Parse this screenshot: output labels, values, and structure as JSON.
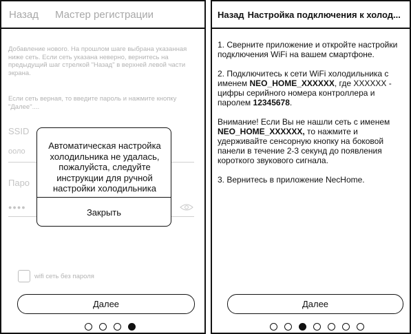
{
  "screen1": {
    "header": {
      "back": "Назад",
      "title": "Мастер регистрации"
    },
    "intro": "Добавление нового. На прошлом шаге выбрана указанная ниже сеть. Если сеть указана неверно, вернитесь на предыдущий шаг стрелкой \"Назад\" в верхней левой части экрана.",
    "intro2": "Если сеть верная, то введите пароль и нажмите кнопку \"Далее\"....",
    "ssid_label": "SSID",
    "ssid_value": "ооло",
    "password_label": "Паро",
    "password_value": "●●●●",
    "checkbox_label": "wifi сеть без пароля",
    "next_button": "Далее",
    "dialog": {
      "message": "Автоматическая настройка холодильника не удалась, пожалуйста, следуйте инструкции для ручной настройки холодильника",
      "close_button": "Закрыть"
    },
    "dots": {
      "total": 4,
      "active": 3
    }
  },
  "screen2": {
    "header": {
      "back": "Назад",
      "title": "Настройка подключения к холод..."
    },
    "step1": "1. Сверните приложение и откройте настройки подключения WiFi на вашем смартфоне.",
    "step2_a": "2. Подключитесь к сети WiFi холодильника с именем ",
    "step2_ssid": "NEO_HOME_XXXXXX",
    "step2_b": ", где XXXXXX - цифры серийного номера контроллера и паролем ",
    "step2_pass": "12345678",
    "step2_c": ".",
    "note_a": "Внимание! Если Вы не нашли сеть с именем ",
    "note_ssid": "NEO_HOME_XXXXXX,",
    "note_b": " то нажмите и удерживайте сенсорную кнопку на боковой панели в течение 2-3 секунд до появления короткого звукового сигнала.",
    "step3": "3. Вернитесь в приложение NecHome.",
    "next_button": "Далее",
    "dots": {
      "total": 7,
      "active": 2
    }
  }
}
